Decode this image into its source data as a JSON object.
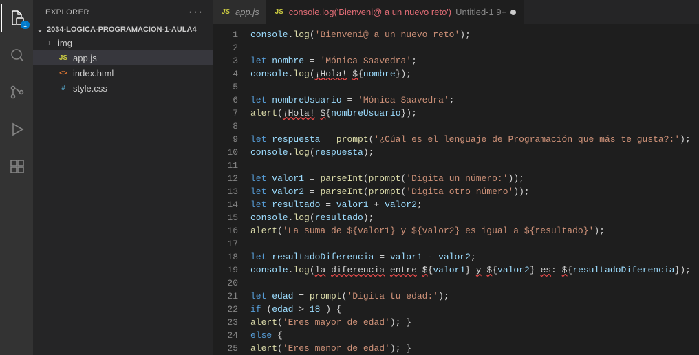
{
  "activityBar": {
    "badge": "1"
  },
  "sidebar": {
    "title": "EXPLORER",
    "project": "2034-LOGICA-PROGRAMACION-1-AULA4",
    "files": {
      "img": "img",
      "appjs": "app.js",
      "indexhtml": "index.html",
      "stylecss": "style.css"
    }
  },
  "tabs": {
    "t1_icon": "JS",
    "t1_label": "app.js",
    "t2_icon": "JS",
    "t2_label": "console.log('Bienveni@ a un nuevo reto')",
    "t2_suffix": "Untitled-1 9+"
  },
  "code": {
    "lines": [
      [
        [
          "obj",
          "console"
        ],
        [
          "pun",
          "."
        ],
        [
          "fn",
          "log"
        ],
        [
          "pun",
          "("
        ],
        [
          "str",
          "'Bienveni@ a un nuevo reto'"
        ],
        [
          "pun",
          ");"
        ]
      ],
      [],
      [
        [
          "kw",
          "let"
        ],
        [
          "pun",
          " "
        ],
        [
          "var",
          "nombre"
        ],
        [
          "pun",
          " = "
        ],
        [
          "str",
          "'Mónica Saavedra'"
        ],
        [
          "pun",
          ";"
        ]
      ],
      [
        [
          "obj",
          "console"
        ],
        [
          "pun",
          "."
        ],
        [
          "fn",
          "log"
        ],
        [
          "pun",
          "("
        ],
        [
          "wavy",
          "¡Hola!"
        ],
        [
          "pun",
          " "
        ],
        [
          "wavy",
          "$"
        ],
        [
          "pun",
          "{"
        ],
        [
          "var",
          "nombre"
        ],
        [
          "pun",
          "});"
        ]
      ],
      [],
      [
        [
          "kw",
          "let"
        ],
        [
          "pun",
          " "
        ],
        [
          "var",
          "nombreUsuario"
        ],
        [
          "pun",
          " = "
        ],
        [
          "str",
          "'Mónica Saavedra'"
        ],
        [
          "pun",
          ";"
        ]
      ],
      [
        [
          "fn",
          "alert"
        ],
        [
          "pun",
          "("
        ],
        [
          "wavy",
          "¡Hola!"
        ],
        [
          "pun",
          " "
        ],
        [
          "wavy",
          "$"
        ],
        [
          "pun",
          "{"
        ],
        [
          "var",
          "nombreUsuario"
        ],
        [
          "pun",
          "});"
        ]
      ],
      [],
      [
        [
          "kw",
          "let"
        ],
        [
          "pun",
          " "
        ],
        [
          "var",
          "respuesta"
        ],
        [
          "pun",
          " = "
        ],
        [
          "fn",
          "prompt"
        ],
        [
          "pun",
          "("
        ],
        [
          "str",
          "'¿Cúal es el lenguaje de Programación que más te gusta?:'"
        ],
        [
          "pun",
          ");"
        ]
      ],
      [
        [
          "obj",
          "console"
        ],
        [
          "pun",
          "."
        ],
        [
          "fn",
          "log"
        ],
        [
          "pun",
          "("
        ],
        [
          "var",
          "respuesta"
        ],
        [
          "pun",
          ");"
        ]
      ],
      [],
      [
        [
          "kw",
          "let"
        ],
        [
          "pun",
          " "
        ],
        [
          "var",
          "valor1"
        ],
        [
          "pun",
          " = "
        ],
        [
          "fn",
          "parseInt"
        ],
        [
          "pun",
          "("
        ],
        [
          "fn",
          "prompt"
        ],
        [
          "pun",
          "("
        ],
        [
          "str",
          "'Digita un número:'"
        ],
        [
          "pun",
          "));"
        ]
      ],
      [
        [
          "kw",
          "let"
        ],
        [
          "pun",
          " "
        ],
        [
          "var",
          "valor2"
        ],
        [
          "pun",
          " = "
        ],
        [
          "fn",
          "parseInt"
        ],
        [
          "pun",
          "("
        ],
        [
          "fn",
          "prompt"
        ],
        [
          "pun",
          "("
        ],
        [
          "str",
          "'Digita otro número'"
        ],
        [
          "pun",
          "));"
        ]
      ],
      [
        [
          "kw",
          "let"
        ],
        [
          "pun",
          " "
        ],
        [
          "var",
          "resultado"
        ],
        [
          "pun",
          " = "
        ],
        [
          "var",
          "valor1"
        ],
        [
          "pun",
          " + "
        ],
        [
          "var",
          "valor2"
        ],
        [
          "pun",
          ";"
        ]
      ],
      [
        [
          "obj",
          "console"
        ],
        [
          "pun",
          "."
        ],
        [
          "fn",
          "log"
        ],
        [
          "pun",
          "("
        ],
        [
          "var",
          "resultado"
        ],
        [
          "pun",
          ");"
        ]
      ],
      [
        [
          "fn",
          "alert"
        ],
        [
          "pun",
          "("
        ],
        [
          "str",
          "'La suma de ${valor1} y ${valor2} es igual a ${resultado}'"
        ],
        [
          "pun",
          ");"
        ]
      ],
      [],
      [
        [
          "kw",
          "let"
        ],
        [
          "pun",
          " "
        ],
        [
          "var",
          "resultadoDiferencia"
        ],
        [
          "pun",
          " = "
        ],
        [
          "var",
          "valor1"
        ],
        [
          "pun",
          " - "
        ],
        [
          "var",
          "valor2"
        ],
        [
          "pun",
          ";"
        ]
      ],
      [
        [
          "obj",
          "console"
        ],
        [
          "pun",
          "."
        ],
        [
          "fn",
          "log"
        ],
        [
          "pun",
          "("
        ],
        [
          "wavy",
          "la"
        ],
        [
          "pun",
          " "
        ],
        [
          "wavy",
          "diferencia"
        ],
        [
          "pun",
          " "
        ],
        [
          "wavy",
          "entre"
        ],
        [
          "pun",
          " "
        ],
        [
          "wavy",
          "$"
        ],
        [
          "pun",
          "{"
        ],
        [
          "var",
          "valor1"
        ],
        [
          "pun",
          "} "
        ],
        [
          "wavy",
          "y"
        ],
        [
          "pun",
          " "
        ],
        [
          "wavy",
          "$"
        ],
        [
          "pun",
          "{"
        ],
        [
          "var",
          "valor2"
        ],
        [
          "pun",
          "} "
        ],
        [
          "wavy",
          "es"
        ],
        [
          "pun",
          ": "
        ],
        [
          "wavy",
          "$"
        ],
        [
          "pun",
          "{"
        ],
        [
          "var",
          "resultadoDiferencia"
        ],
        [
          "pun",
          "});"
        ]
      ],
      [],
      [
        [
          "kw",
          "let"
        ],
        [
          "pun",
          " "
        ],
        [
          "var",
          "edad"
        ],
        [
          "pun",
          " = "
        ],
        [
          "fn",
          "prompt"
        ],
        [
          "pun",
          "("
        ],
        [
          "str",
          "'Digita tu edad:'"
        ],
        [
          "pun",
          ");"
        ]
      ],
      [
        [
          "kw",
          "if"
        ],
        [
          "pun",
          " ("
        ],
        [
          "var",
          "edad"
        ],
        [
          "pun",
          " > "
        ],
        [
          "var",
          "18"
        ],
        [
          "pun",
          " ) {"
        ]
      ],
      [
        [
          "fn",
          "alert"
        ],
        [
          "pun",
          "("
        ],
        [
          "str",
          "'Eres mayor de edad'"
        ],
        [
          "pun",
          "); }"
        ]
      ],
      [
        [
          "kw",
          "else"
        ],
        [
          "pun",
          " {"
        ]
      ],
      [
        [
          "fn",
          "alert"
        ],
        [
          "pun",
          "("
        ],
        [
          "str",
          "'Eres menor de edad'"
        ],
        [
          "pun",
          "); }"
        ]
      ]
    ]
  }
}
